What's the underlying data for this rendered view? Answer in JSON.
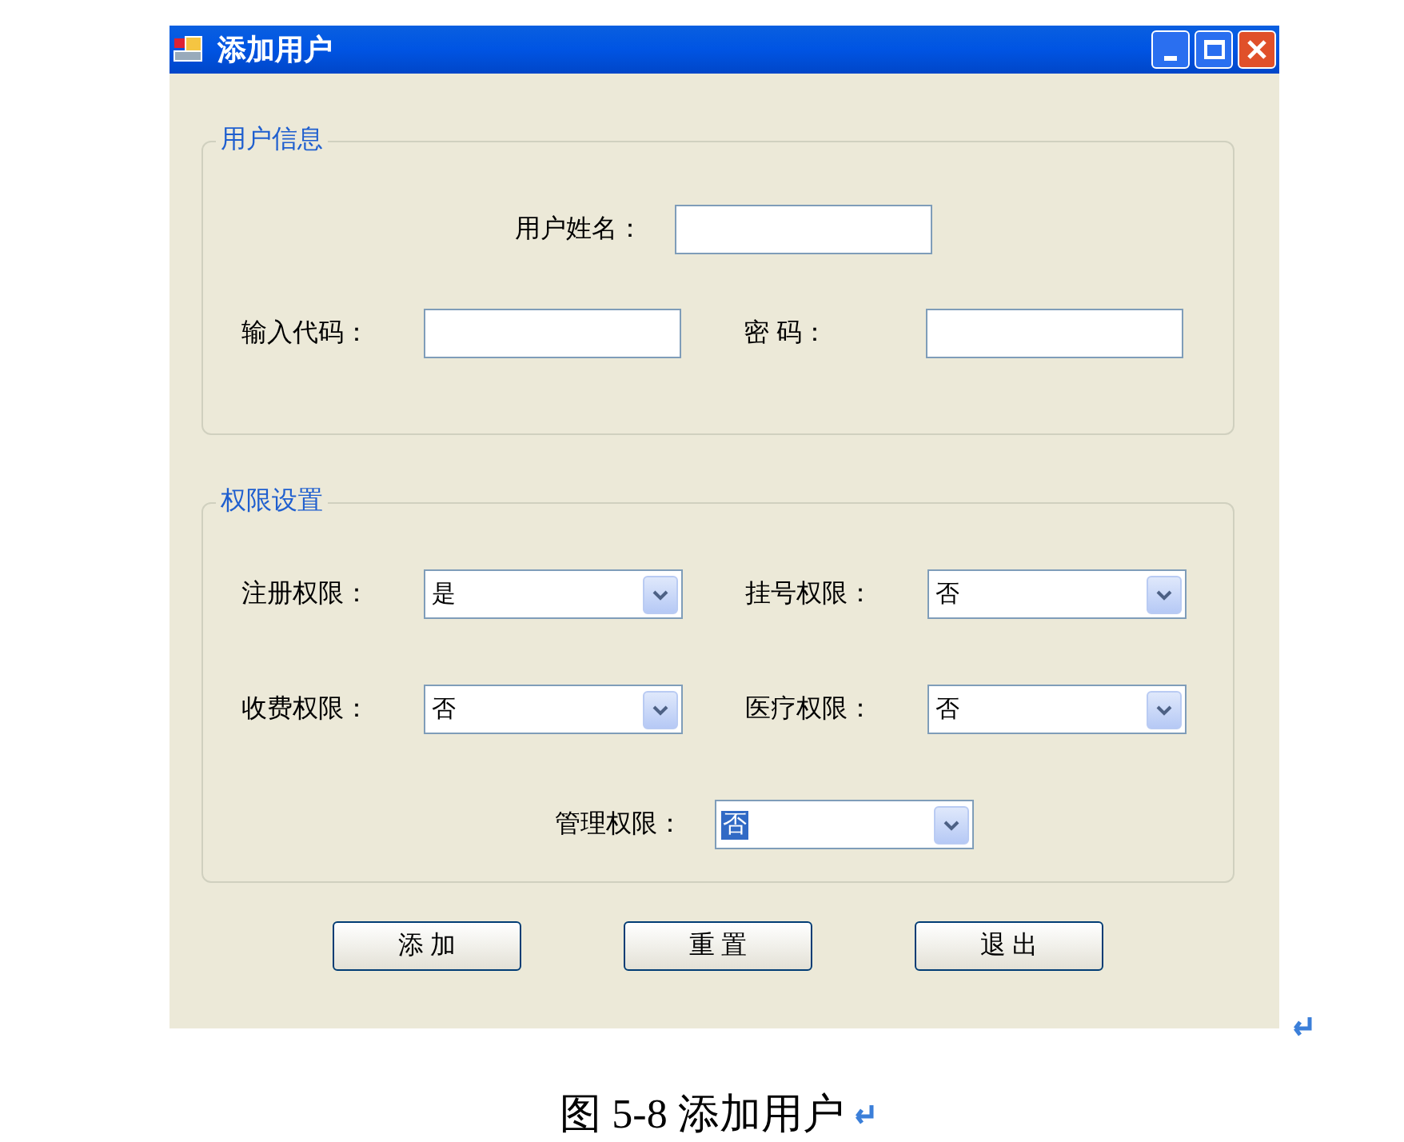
{
  "window": {
    "title": "添加用户"
  },
  "groups": [
    {
      "title": "用户信息",
      "rows": [
        [
          {
            "kind": "text",
            "label": "用户姓名："
          }
        ],
        [
          {
            "kind": "text",
            "label": "输入代码："
          },
          {
            "kind": "text",
            "label": "密 码："
          }
        ]
      ]
    },
    {
      "title": "权限设置",
      "rows": [
        [
          {
            "kind": "select",
            "label": "注册权限：",
            "value": "是",
            "focused": false
          },
          {
            "kind": "select",
            "label": "挂号权限：",
            "value": "否",
            "focused": false
          }
        ],
        [
          {
            "kind": "select",
            "label": "收费权限：",
            "value": "否",
            "focused": false
          },
          {
            "kind": "select",
            "label": "医疗权限：",
            "value": "否",
            "focused": false
          }
        ],
        [
          {
            "kind": "select",
            "label": "管理权限：",
            "value": "否",
            "focused": true
          }
        ]
      ]
    }
  ],
  "buttons": [
    "添 加",
    "重 置",
    "退 出"
  ],
  "caption": "图 5-8 添加用户"
}
